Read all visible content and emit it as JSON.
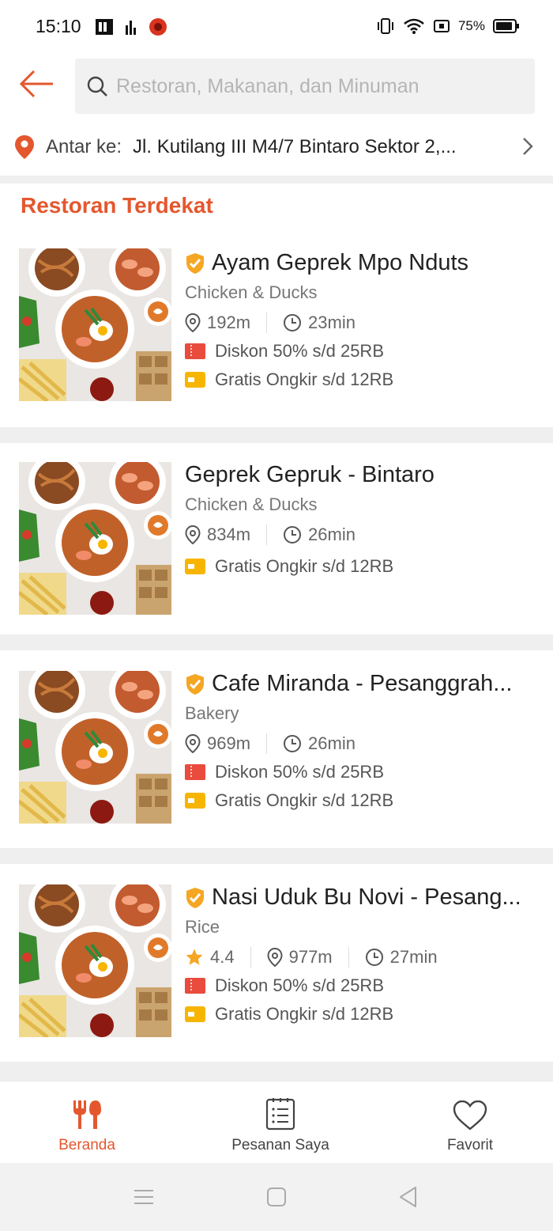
{
  "status_bar": {
    "time": "15:10",
    "battery": "75%"
  },
  "header": {
    "search_placeholder": "Restoran, Makanan, dan Minuman"
  },
  "address": {
    "label": "Antar ke:",
    "value": "Jl. Kutilang III M4/7 Bintaro Sektor 2,..."
  },
  "section": {
    "title": "Restoran Terdekat"
  },
  "restaurants": [
    {
      "name": "Ayam Geprek Mpo Nduts",
      "category": "Chicken & Ducks",
      "distance": "192m",
      "time": "23min",
      "discount": "Diskon 50% s/d 25RB",
      "shipping": "Gratis Ongkir s/d 12RB"
    },
    {
      "name": "Geprek Gepruk - Bintaro",
      "category": "Chicken & Ducks",
      "distance": "834m",
      "time": "26min",
      "shipping": "Gratis Ongkir s/d 12RB"
    },
    {
      "name": "Cafe Miranda - Pesanggrah...",
      "category": "Bakery",
      "distance": "969m",
      "time": "26min",
      "discount": "Diskon 50% s/d 25RB",
      "shipping": "Gratis Ongkir s/d 12RB"
    },
    {
      "name": "Nasi Uduk Bu Novi - Pesang...",
      "category": "Rice",
      "rating": "4.4",
      "distance": "977m",
      "time": "27min",
      "discount": "Diskon 50% s/d 25RB",
      "shipping": "Gratis Ongkir s/d 12RB"
    }
  ],
  "bottom_nav": {
    "home": "Beranda",
    "orders": "Pesanan Saya",
    "favorites": "Favorit"
  },
  "colors": {
    "accent": "#e4572e",
    "badge": "#f5a623",
    "promo_red": "#e94b3c",
    "promo_yellow": "#f7b500"
  },
  "icons": [
    "back-arrow-icon",
    "search-icon",
    "location-pin-icon",
    "chevron-right-icon",
    "verified-badge-icon",
    "distance-pin-icon",
    "clock-icon",
    "discount-ticket-icon",
    "free-shipping-icon",
    "star-icon",
    "fork-knife-icon",
    "orders-list-icon",
    "heart-icon"
  ]
}
